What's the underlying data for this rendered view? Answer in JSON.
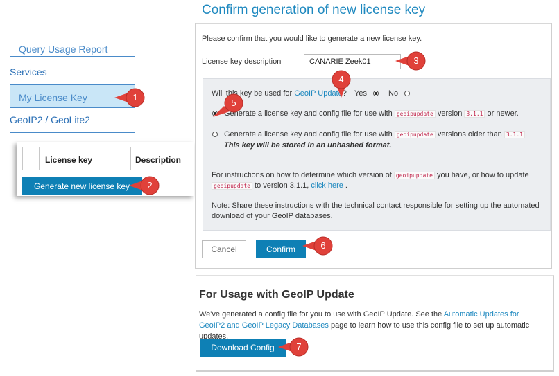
{
  "sidebar": {
    "query_usage_label": "Query Usage Report",
    "services_heading": "Services",
    "my_license_key_label": "My License Key",
    "geoip_heading": "GeoIP2 / GeoLite2"
  },
  "keys_table": {
    "col_license_key": "License key",
    "col_description": "Description",
    "generate_button": "Generate new license key"
  },
  "confirm_panel": {
    "title": "Confirm generation of new license key",
    "intro": "Please confirm that you would like to generate a new license key.",
    "description_label": "License key description",
    "description_value": "CANARIE Zeek01",
    "question_prefix": "Will this key be used for",
    "question_link": "GeoIP Update",
    "question_suffix": "?",
    "yes_label": "Yes",
    "no_label": "No",
    "opt1_prefix": "Generate a license key and config file for use with",
    "opt1_code": "geoipupdate",
    "opt1_mid": "version",
    "opt1_version": "3.1.1",
    "opt1_suffix": "or newer.",
    "opt2_prefix": "Generate a license key and config file for use with",
    "opt2_code": "geoipupdate",
    "opt2_mid": "versions older than",
    "opt2_version": "3.1.1",
    "opt2_suffix": ".",
    "opt2_note": "This key will be stored in an unhashed format.",
    "instr_prefix": "For instructions on how to determine which version of",
    "instr_code1": "geoipupdate",
    "instr_mid": "you have, or how to update",
    "instr_code2": "geoipupdate",
    "instr_to": "to version 3.1.1,",
    "instr_link": "click here",
    "instr_end": ".",
    "note_line1": "Note: Share these instructions with the technical contact responsible for setting up the automated",
    "note_line2": "download of your GeoIP databases.",
    "cancel_button": "Cancel",
    "confirm_button": "Confirm",
    "selected_option": "yes",
    "selected_version_option": "3.1.1 or newer"
  },
  "usage_panel": {
    "title": "For Usage with GeoIP Update",
    "text_prefix": "We've generated a config file for you to use with GeoIP Update. See the",
    "text_link": "Automatic Updates for GeoIP2 and GeoIP Legacy Databases",
    "text_suffix": "page to learn how to use this config file to set up automatic updates.",
    "download_button": "Download Config"
  },
  "callouts": [
    "1",
    "2",
    "3",
    "4",
    "5",
    "6",
    "7"
  ],
  "colors": {
    "accent": "#0e80b5",
    "title": "#1d88bf",
    "callout": "#e0413a",
    "nav_selected_bg": "#c9e6f7"
  }
}
